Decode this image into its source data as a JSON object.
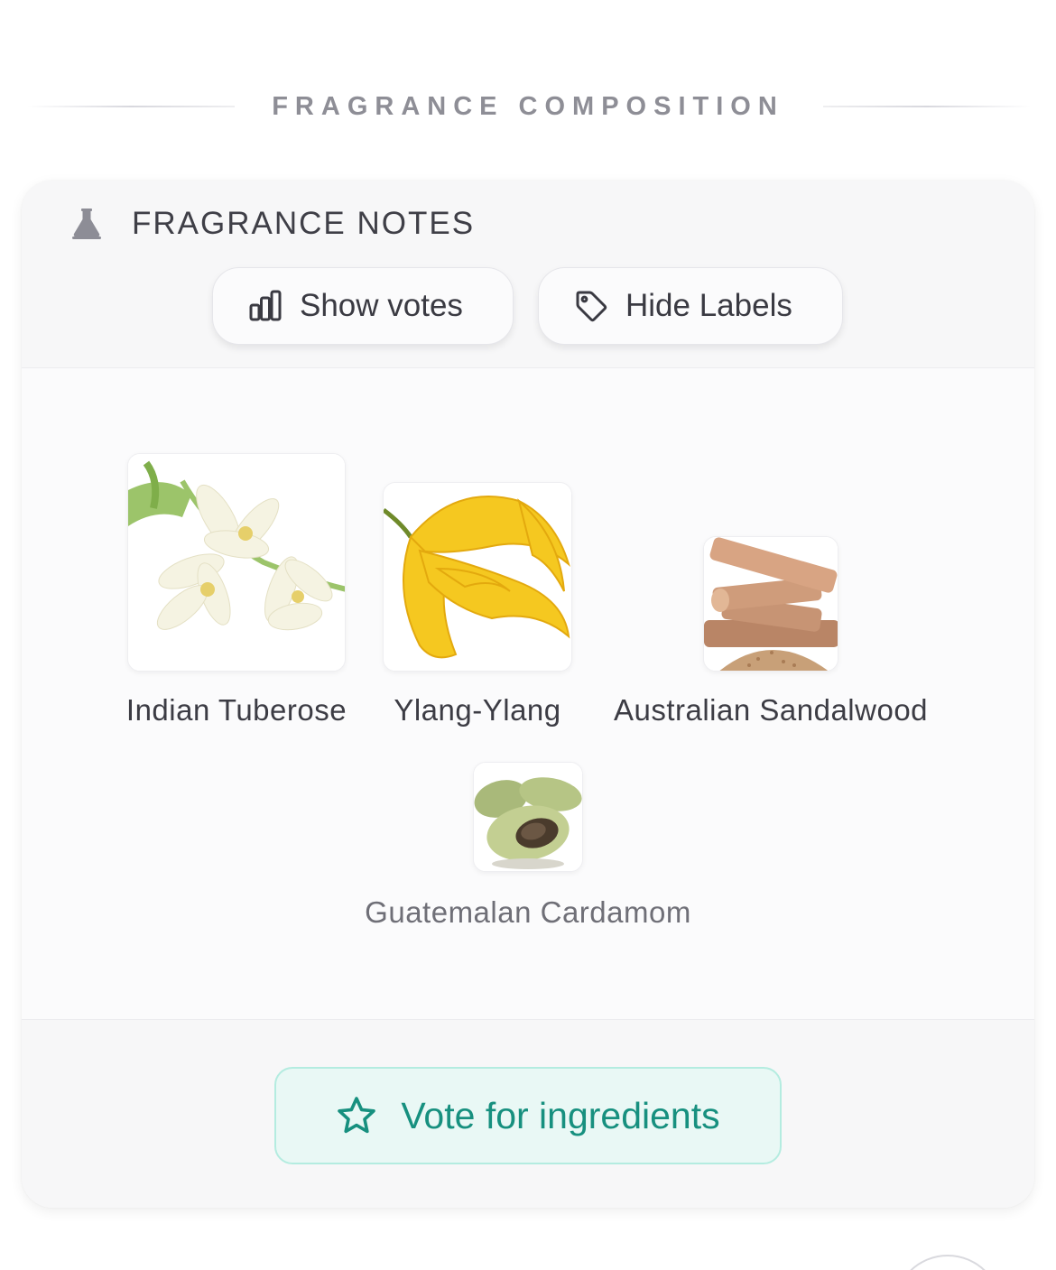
{
  "section": {
    "title": "FRAGRANCE COMPOSITION"
  },
  "card": {
    "title": "FRAGRANCE NOTES",
    "icon": "flask-icon",
    "buttons": {
      "show_votes": "Show votes",
      "hide_labels": "Hide Labels"
    },
    "notes": [
      {
        "name": "Indian Tuberose",
        "image": "tuberose-flower-image"
      },
      {
        "name": "Ylang-Ylang",
        "image": "ylang-ylang-flower-image"
      },
      {
        "name": "Australian Sandalwood",
        "image": "sandalwood-image"
      },
      {
        "name": "Guatemalan Cardamom",
        "image": "cardamom-image"
      }
    ],
    "vote_button": "Vote for ingredients"
  },
  "colors": {
    "accent": "#17907f",
    "accent_bg": "#e9f8f5",
    "accent_border": "#b4ece0",
    "title_gray": "#8e8e96"
  }
}
